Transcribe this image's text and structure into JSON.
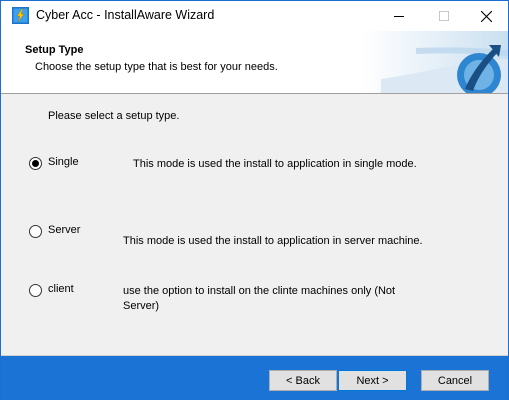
{
  "window": {
    "title": "Cyber Acc - InstallAware Wizard",
    "icon": "installaware-icon",
    "controls": {
      "minimize": "minimize-icon",
      "maximize": "maximize-icon",
      "close": "close-icon"
    }
  },
  "header": {
    "title": "Setup Type",
    "subtitle": "Choose the setup type that is best for your needs."
  },
  "main": {
    "prompt": "Please select a setup type.",
    "options": [
      {
        "label": "Single",
        "selected": true,
        "description": "This mode is used the install to application in single mode."
      },
      {
        "label": "Server",
        "selected": false,
        "description": "This mode is used the install to application in server machine."
      },
      {
        "label": "client",
        "selected": false,
        "description": "use the option to install on the clinte machines only (Not Server)"
      }
    ]
  },
  "footer": {
    "back_label": "< Back",
    "next_label": "Next >",
    "cancel_label": "Cancel"
  },
  "colors": {
    "accent": "#1c73d6",
    "window_border": "#1a6fd1",
    "background": "#f0f0f0"
  }
}
